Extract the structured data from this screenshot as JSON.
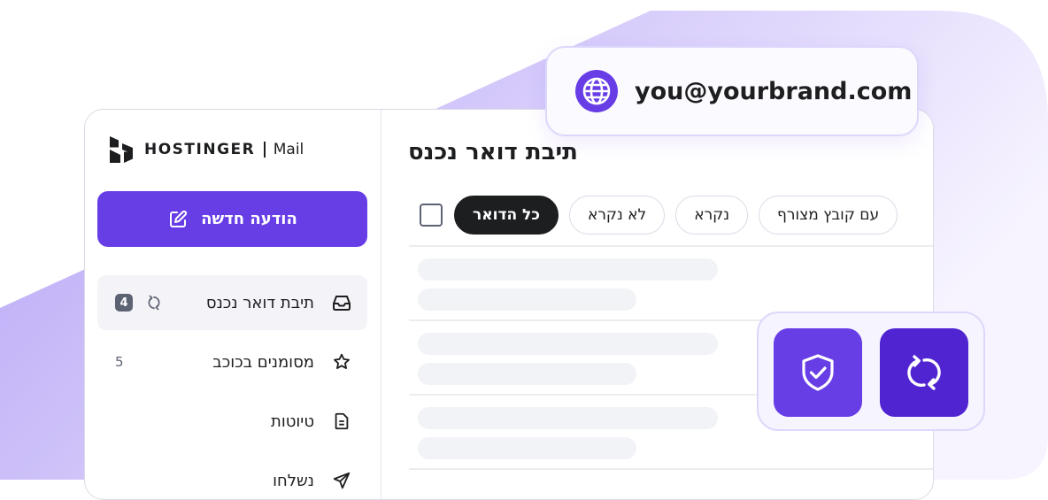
{
  "brand": {
    "name": "HOSTINGER",
    "product": "Mail"
  },
  "compose": {
    "label": "הודעה חדשה"
  },
  "nav": [
    {
      "label": "תיבת דואר נכנס",
      "count": "4"
    },
    {
      "label": "מסומנים בכוכב",
      "count": "5"
    },
    {
      "label": "טיוטות"
    },
    {
      "label": "נשלחו"
    }
  ],
  "main": {
    "title": "תיבת דואר נכנס",
    "filters": [
      "כל הדואר",
      "לא נקרא",
      "נקרא",
      "עם קובץ מצורף"
    ]
  },
  "email_card": {
    "address": "you@yourbrand.com"
  },
  "colors": {
    "accent": "#673de6",
    "accent_dark": "#5025d1",
    "chip_active": "#1d1e20"
  }
}
